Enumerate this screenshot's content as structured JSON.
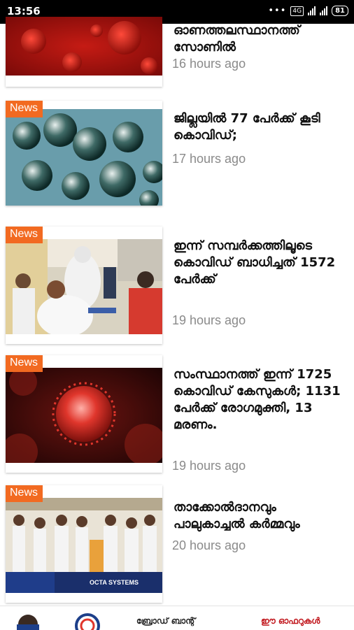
{
  "status_bar": {
    "time": "13:56",
    "dots": "•••",
    "net_badge": "4G",
    "battery": "81"
  },
  "feed": {
    "tag_label": "News",
    "items": [
      {
        "title": "ഓണത്തലസ്ഥാനത്ത് സോണിൽ",
        "time": "16 hours ago",
        "has_tag": false,
        "image": "coronavirus red"
      },
      {
        "title": "ജില്ലയിൽ 77 പേർക്ക് കൂടി കൊവിഡ്;",
        "time": "17 hours ago",
        "has_tag": true,
        "image": "coronavirus teal"
      },
      {
        "title": "ഇന്ന് സമ്പർക്കത്തിലൂടെ കൊവിഡ് ബാധിച്ചത് 1572 പേർക്ക്",
        "time": "19 hours ago",
        "has_tag": true,
        "image": "covid testing"
      },
      {
        "title": "സംസ്ഥാനത്ത് ഇന്ന് 1725 കൊവിഡ് കേസുകൾ; 1131 പേർക്ക് രോഗമുക്തി, 13 മരണം.",
        "time": "19 hours ago",
        "has_tag": true,
        "image": "coronavirus dark red"
      },
      {
        "title": "താക്കോൽദാനവും പാലുകാച്ചൽ കർമ്മവും",
        "time": "20 hours ago",
        "has_tag": true,
        "image": "group photo"
      }
    ]
  },
  "ad": {
    "center_text": "ബ്രോഡ് ബാന്റ്",
    "right_text": "ഈ ഓഫറുകൾ",
    "brand_text": "OCTA SYSTEMS"
  },
  "colors": {
    "tag": "#f26a21",
    "time": "#8a8a8a",
    "title": "#111111"
  }
}
